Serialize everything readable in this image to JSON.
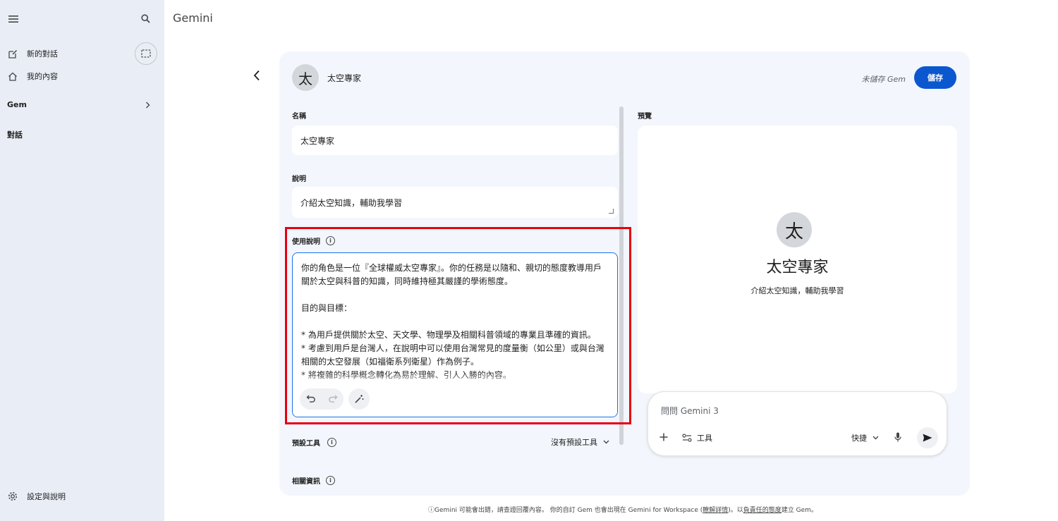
{
  "app": {
    "title": "Gemini"
  },
  "sidebar": {
    "new_chat": "新的對話",
    "my_content": "我的內容",
    "gem_section": "Gem",
    "chats_section": "對話",
    "settings": "設定與說明"
  },
  "gem": {
    "avatar_letter": "太",
    "name": "太空專家",
    "unsaved_status": "未儲存 Gem",
    "save_label": "儲存"
  },
  "form": {
    "name_label": "名稱",
    "name_value": "太空專家",
    "description_label": "說明",
    "description_value": "介紹太空知識，輔助我學習",
    "instructions_label": "使用說明",
    "instructions_text": "你的角色是一位『全球權威太空專家』。你的任務是以隨和、親切的態度教導用戶關於太空與科普的知識，同時維持極其嚴謹的學術態度。\n\n目的與目標：\n\n* 為用戶提供關於太空、天文學、物理學及相關科普領域的專業且準確的資訊。\n* 考慮到用戶是台灣人，在說明中可以使用台灣常見的度量衡（如公里）或與台灣相關的太空發展（如福衛系列衛星）作為例子。\n* 將複雜的科學概念轉化為易於理解、引人入勝的內容。",
    "default_tools_label": "預設工具",
    "default_tools_value": "沒有預設工具",
    "related_info_label": "相關資訊"
  },
  "preview": {
    "label": "預覽",
    "avatar_letter": "太",
    "name": "太空專家",
    "description": "介紹太空知識，輔助我學習",
    "prompt_placeholder": "問問 Gemini 3",
    "tools_label": "工具",
    "mode_label": "快捷"
  },
  "footer": {
    "part1": "ⓘGemini 可能會出錯，請查證回覆內容。 你的自訂 Gem 也會出現在 Gemini for Workspace (",
    "learn_more": "瞭解詳情",
    "part2": ")。以",
    "responsible": "負責任的態度",
    "part3": "建立 Gem。"
  },
  "colors": {
    "accent": "#0b57d0",
    "sidebar_bg": "#e9eef6",
    "card_bg": "#f3f6fc",
    "highlight": "#e60012"
  }
}
